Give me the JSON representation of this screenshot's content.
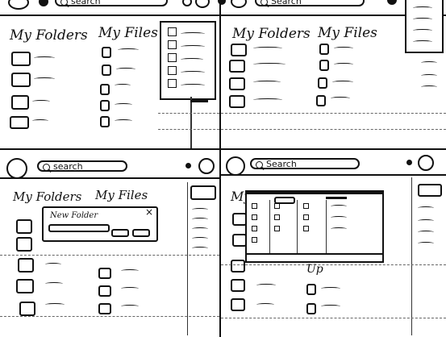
{
  "panels": [
    {
      "id": "top-left",
      "search_text": "search",
      "folders_title": "My Folders",
      "files_title": "My Files"
    },
    {
      "id": "top-right",
      "search_text": "Search",
      "folders_title": "My Folders",
      "files_title": "My Files"
    },
    {
      "id": "bottom-left",
      "search_text": "search",
      "folders_title": "My Folders",
      "files_title": "My Files",
      "dialog": {
        "title": "New Folder",
        "close_glyph": "×"
      }
    },
    {
      "id": "bottom-right",
      "search_text": "Search",
      "folders_title": "My",
      "files_title": "Up"
    }
  ],
  "icons": {
    "logo": "logo-circle-icon",
    "settings": "settings-icon",
    "search": "search-icon",
    "folder": "folder-icon",
    "file": "file-icon",
    "close": "close-icon"
  },
  "colors": {
    "ink": "#111111",
    "paper": "#ffffff"
  }
}
